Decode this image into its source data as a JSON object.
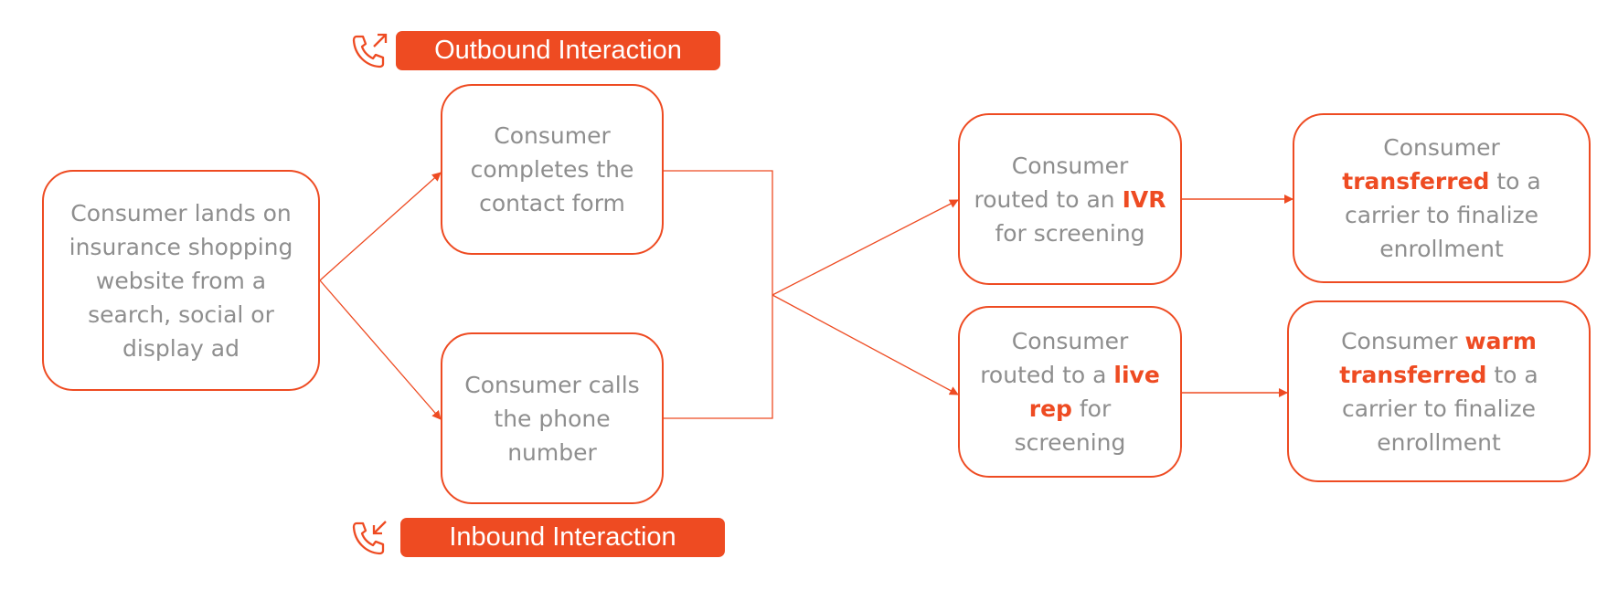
{
  "diagram": {
    "accent_color": "#ee4b22",
    "text_color": "#8e8e8e",
    "labels": {
      "outbound": {
        "icon": "phone-outgoing-icon",
        "text": "Outbound Interaction"
      },
      "inbound": {
        "icon": "phone-incoming-icon",
        "text": "Inbound Interaction"
      }
    },
    "nodes": {
      "start": {
        "parts": [
          {
            "t": "Consumer lands on insurance shopping website from a search, social or display ad",
            "hl": false
          }
        ]
      },
      "form": {
        "parts": [
          {
            "t": "Consumer completes the contact form",
            "hl": false
          }
        ]
      },
      "call": {
        "parts": [
          {
            "t": "Consumer calls the phone number",
            "hl": false
          }
        ]
      },
      "ivr": {
        "parts": [
          {
            "t": "Consumer routed to an ",
            "hl": false
          },
          {
            "t": "IVR",
            "hl": true
          },
          {
            "t": " for screening",
            "hl": false
          }
        ]
      },
      "rep": {
        "parts": [
          {
            "t": "Consumer routed to a ",
            "hl": false
          },
          {
            "t": "live rep",
            "hl": true
          },
          {
            "t": " for screening",
            "hl": false
          }
        ]
      },
      "transfer": {
        "parts": [
          {
            "t": "Consumer ",
            "hl": false
          },
          {
            "t": "transferred",
            "hl": true
          },
          {
            "t": " to a carrier to finalize enrollment",
            "hl": false
          }
        ]
      },
      "warm": {
        "parts": [
          {
            "t": "Consumer ",
            "hl": false
          },
          {
            "t": "warm transferred",
            "hl": true
          },
          {
            "t": " to a carrier to finalize enrollment",
            "hl": false
          }
        ]
      }
    },
    "edges": [
      {
        "from": "start",
        "to": "form"
      },
      {
        "from": "start",
        "to": "call"
      },
      {
        "from": "form",
        "to": "ivr"
      },
      {
        "from": "form",
        "to": "rep"
      },
      {
        "from": "call",
        "to": "ivr"
      },
      {
        "from": "call",
        "to": "rep"
      },
      {
        "from": "ivr",
        "to": "transfer"
      },
      {
        "from": "rep",
        "to": "warm"
      }
    ]
  }
}
